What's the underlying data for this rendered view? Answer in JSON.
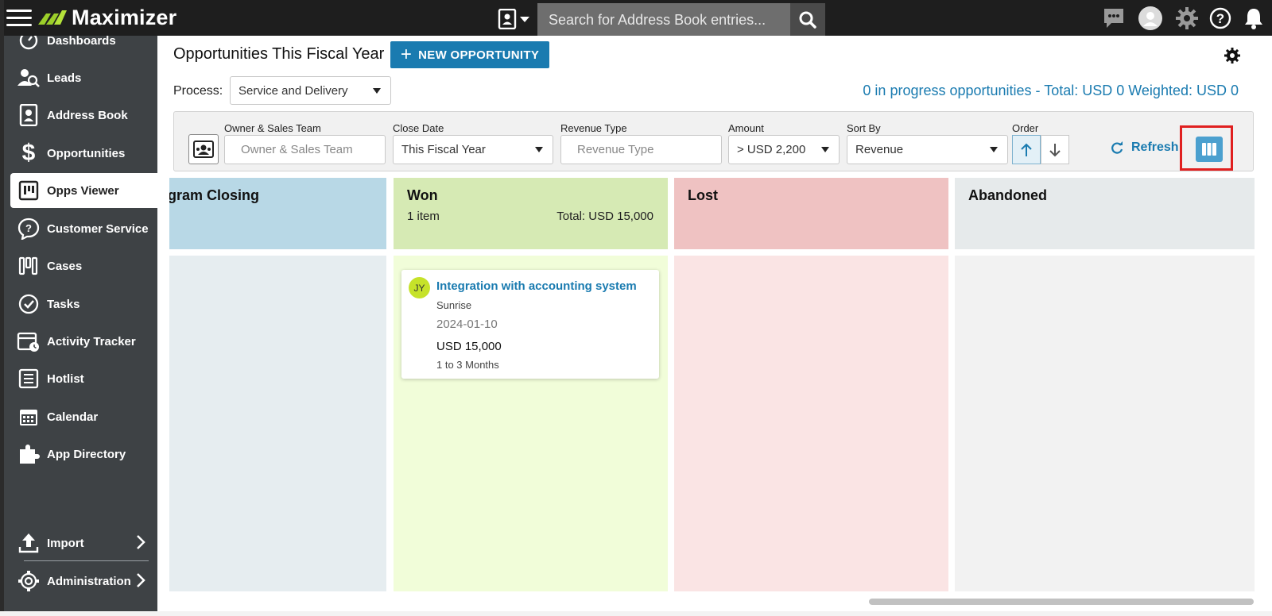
{
  "topbar": {
    "app_name": "Maximizer",
    "search_placeholder": "Search for Address Book entries...",
    "icons": [
      "menu-icon",
      "address-book-dropdown-icon",
      "search-icon",
      "chat-icon",
      "user-avatar-icon",
      "gear-icon",
      "help-icon",
      "bell-icon"
    ]
  },
  "sidebar": {
    "items": [
      {
        "label": "Dashboards",
        "icon": "dashboard-icon"
      },
      {
        "label": "Leads",
        "icon": "leads-icon"
      },
      {
        "label": "Address Book",
        "icon": "address-book-icon"
      },
      {
        "label": "Opportunities",
        "icon": "dollar-icon"
      },
      {
        "label": "Opps Viewer",
        "icon": "kanban-icon",
        "active": true
      },
      {
        "label": "Customer Service",
        "icon": "customer-service-icon"
      },
      {
        "label": "Cases",
        "icon": "cases-icon"
      },
      {
        "label": "Tasks",
        "icon": "check-circle-icon"
      },
      {
        "label": "Activity Tracker",
        "icon": "calendar-clock-icon"
      },
      {
        "label": "Hotlist",
        "icon": "list-icon"
      },
      {
        "label": "Calendar",
        "icon": "calendar-icon"
      },
      {
        "label": "App Directory",
        "icon": "puzzle-icon"
      }
    ],
    "bottom": [
      {
        "label": "Import",
        "icon": "upload-icon"
      },
      {
        "label": "Administration",
        "icon": "gear-icon"
      }
    ]
  },
  "main": {
    "title": "Opportunities This Fiscal Year",
    "new_button": "NEW OPPORTUNITY",
    "process_label": "Process:",
    "process_value": "Service and Delivery",
    "summary": "0 in progress opportunities - Total: USD 0 Weighted: USD 0"
  },
  "filters": {
    "owner": {
      "label": "Owner & Sales Team",
      "placeholder": "Owner & Sales Team"
    },
    "close_date": {
      "label": "Close Date",
      "value": "This Fiscal Year"
    },
    "revenue_type": {
      "label": "Revenue Type",
      "placeholder": "Revenue Type"
    },
    "amount": {
      "label": "Amount",
      "value": "> USD 2,200"
    },
    "sort_by": {
      "label": "Sort By",
      "value": "Revenue"
    },
    "order": {
      "label": "Order"
    },
    "refresh": "Refresh"
  },
  "board": {
    "columns": [
      {
        "title": "gram Closing",
        "count": "",
        "total": "",
        "head_color": "#b8d8e6",
        "body_color": "#e6edf0"
      },
      {
        "title": "Won",
        "count": "1 item",
        "total": "Total: USD 15,000",
        "head_color": "#d6eab4",
        "body_color": "#f1fdd9"
      },
      {
        "title": "Lost",
        "count": "",
        "total": "",
        "head_color": "#efc2c2",
        "body_color": "#fae4e4"
      },
      {
        "title": "Abandoned",
        "count": "",
        "total": "",
        "head_color": "#e6eaeb",
        "body_color": "#f2f2f2"
      }
    ],
    "card": {
      "initials": "JY",
      "title": "Integration with accounting system",
      "company": "Sunrise",
      "date": "2024-01-10",
      "amount": "USD 15,000",
      "term": "1 to 3 Months"
    }
  }
}
